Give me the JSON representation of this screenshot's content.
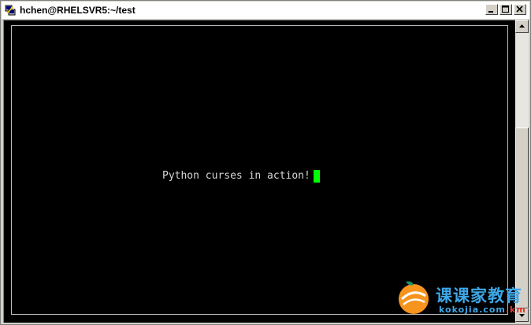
{
  "window": {
    "title": "hchen@RHELSVR5:~/test",
    "icon": "putty-terminal-icon"
  },
  "titlebar_buttons": {
    "minimize": "minimize-icon",
    "maximize": "maximize-icon",
    "close": "close-icon"
  },
  "terminal": {
    "line": "Python curses in action!",
    "cursor_color": "#00ff00",
    "background": "#000000"
  },
  "watermark": {
    "chinese": "课课家教育",
    "url_main": "kokojia.com",
    "url_tld": ".km",
    "accent": "#3ea7e8",
    "logo_color": "#f7941d"
  }
}
